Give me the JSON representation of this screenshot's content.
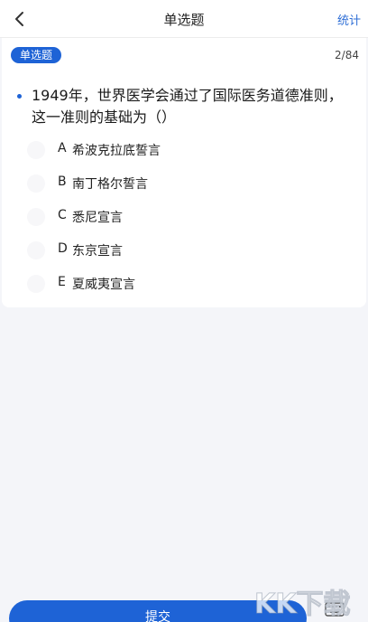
{
  "header": {
    "title": "单选题",
    "stats_label": "统计"
  },
  "question": {
    "type_badge": "单选题",
    "counter": "2/84",
    "text": "1949年，世界医学会通过了国际医务道德准则，这一准则的基础为（）"
  },
  "options": [
    {
      "label": "A",
      "text": "希波克拉底誓言"
    },
    {
      "label": "B",
      "text": "南丁格尔誓言"
    },
    {
      "label": "C",
      "text": "悉尼宣言"
    },
    {
      "label": "D",
      "text": "东京宣言"
    },
    {
      "label": "E",
      "text": "夏威夷宣言"
    }
  ],
  "footer": {
    "submit_label": "提交"
  },
  "watermark": {
    "text": "KK下载"
  },
  "colors": {
    "accent": "#1e63d6",
    "link": "#2f6fd6",
    "background": "#f4f5f9"
  },
  "icons": [
    "back-arrow-icon",
    "keyboard-icon"
  ]
}
